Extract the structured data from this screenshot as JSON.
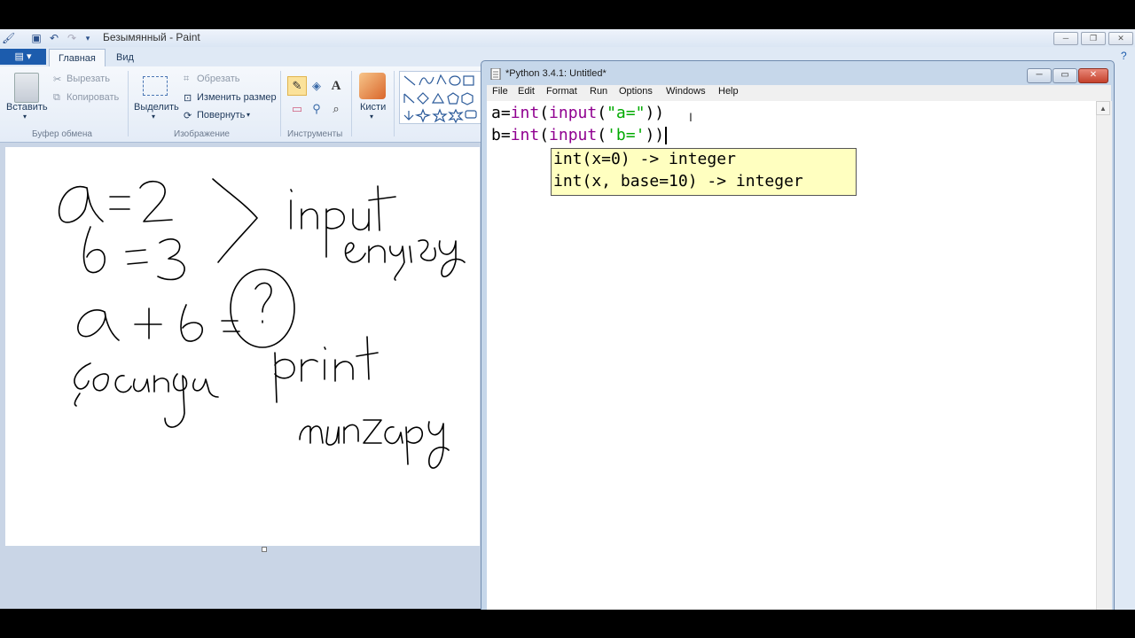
{
  "paint": {
    "title": "Безымянный - Paint",
    "file_menu_label": "▤ ▾",
    "tabs": [
      "Главная",
      "Вид"
    ],
    "clipboard": {
      "paste": "Вставить",
      "cut": "Вырезать",
      "copy": "Копировать",
      "group": "Буфер обмена"
    },
    "image": {
      "select": "Выделить",
      "crop": "Обрезать",
      "resize": "Изменить размер",
      "rotate": "Повернуть",
      "group": "Изображение"
    },
    "tools": {
      "group": "Инструменты",
      "text_tool": "A"
    },
    "brushes": "Кисти"
  },
  "idle": {
    "title": "*Python 3.4.1: Untitled*",
    "menu": [
      "File",
      "Edit",
      "Format",
      "Run",
      "Options",
      "Windows",
      "Help"
    ],
    "code_lines": [
      [
        {
          "t": "a=",
          "c": "plain"
        },
        {
          "t": "int",
          "c": "kw"
        },
        {
          "t": "(",
          "c": "plain"
        },
        {
          "t": "input",
          "c": "kw"
        },
        {
          "t": "(",
          "c": "plain"
        },
        {
          "t": "\"a=\"",
          "c": "str"
        },
        {
          "t": "))",
          "c": "plain"
        }
      ],
      [
        {
          "t": "b=",
          "c": "plain"
        },
        {
          "t": "int",
          "c": "kw"
        },
        {
          "t": "(",
          "c": "plain"
        },
        {
          "t": "input",
          "c": "kw"
        },
        {
          "t": "(",
          "c": "plain"
        },
        {
          "t": "'b=",
          "c": "str"
        },
        {
          "t": "'",
          "c": "str"
        },
        {
          "t": "))",
          "c": "plain"
        }
      ]
    ],
    "calltip": [
      "int(x=0) -> integer",
      "int(x, base=10) -> integer"
    ]
  },
  "colors": {
    "keyword": "#900090",
    "string": "#00aa00",
    "calltip_bg": "#ffffc0"
  }
}
